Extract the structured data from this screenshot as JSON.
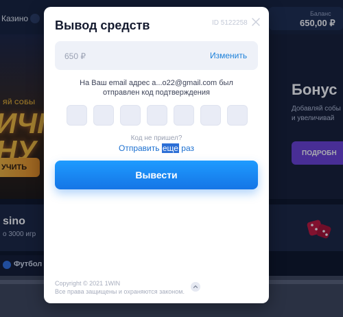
{
  "background": {
    "nav": {
      "casino_label": "Казино"
    },
    "balance": {
      "label": "Баланс",
      "value": "650,00 ₽"
    },
    "promo_left": {
      "headline": "ЯЙ СОБЫ",
      "big_text": "ИЧІ\nНУ",
      "button_label": "УЧИТЬ"
    },
    "promo_right": {
      "title": "Бонус",
      "subtitle_line1": "Добавляй собы",
      "subtitle_line2": "и увеличивай",
      "button_label": "ПОДРОБН"
    },
    "casino_card": {
      "title": "sino",
      "games": "о 3000 игр"
    },
    "sport_tab": {
      "label": "Футбол"
    }
  },
  "modal": {
    "title": "Вывод средств",
    "id_text": "ID 5122258",
    "amount": {
      "value": "650 ₽",
      "change_label": "Изменить"
    },
    "info_line1": "На Ваш email адрес a...o22@gmail.com был",
    "info_line2": "отправлен код подтверждения",
    "code_length": 7,
    "no_code_text": "Код не пришел?",
    "resend_before": "Отправить ",
    "resend_highlight": "еще",
    "resend_after": " раз",
    "submit_label": "Вывести",
    "copyright_line1": "Copyright © 2021 1WIN",
    "copyright_line2": "Все права защищены и охраняются законом."
  },
  "colors": {
    "accent": "#1a7fd9",
    "button": "#1e88f5",
    "modal_bg": "#ffffff",
    "code_cell": "#e9ecf6"
  }
}
